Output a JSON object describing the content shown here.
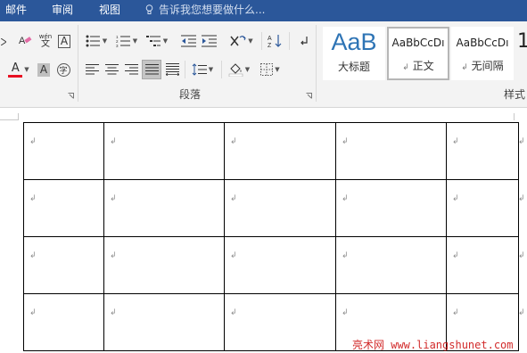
{
  "tabs": [
    "邮件",
    "审阅",
    "视图"
  ],
  "tell_me": "告诉我您想要做什么...",
  "ribbon": {
    "paragraph_group_label": "段落",
    "styles_group_label": "样式",
    "styles": [
      {
        "sample": "AaB",
        "name": "大标题",
        "mark": ""
      },
      {
        "sample": "AaBbCcDı",
        "name": "正文",
        "mark": "↲"
      },
      {
        "sample": "AaBbCcDı",
        "name": "无间隔",
        "mark": "↲"
      },
      {
        "sample": "1",
        "name": "",
        "mark": ""
      }
    ],
    "phonetic_top": "wén",
    "phonetic_bottom": "文",
    "enclosed_char": "字",
    "font_color_letter": "A",
    "char_shade_letter": "A",
    "char_border_letter": "A",
    "accent_red": "#e81123",
    "ribbon_blue": "#2b579a"
  },
  "document": {
    "paragraph_mark": "↲",
    "table": {
      "rows": 4,
      "cols": 5,
      "cells": [
        [
          "↲",
          "↲",
          "↲",
          "↲",
          "↲"
        ],
        [
          "↲",
          "↲",
          "↲",
          "↲",
          "↲"
        ],
        [
          "↲",
          "↲",
          "↲",
          "↲",
          "↲"
        ],
        [
          "↲",
          "↲",
          "↲",
          "↲",
          "↲"
        ]
      ]
    }
  },
  "watermark": "亮术网 www.liangshunet.com"
}
